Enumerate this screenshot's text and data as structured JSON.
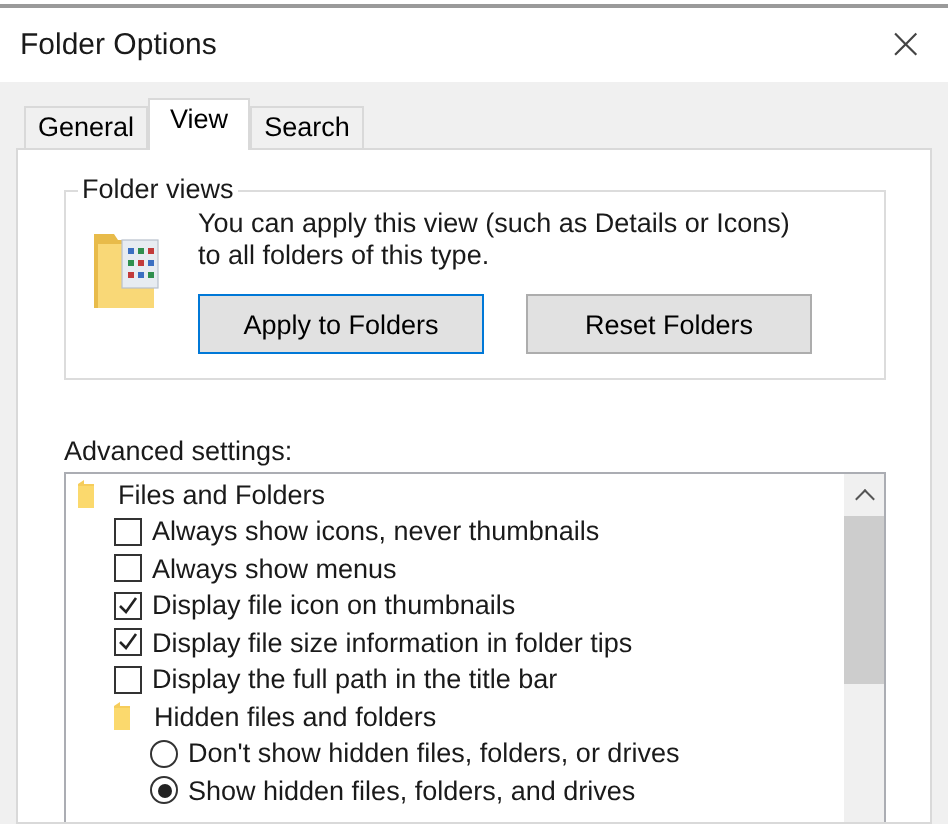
{
  "window": {
    "title": "Folder Options",
    "close": "×"
  },
  "tabs": [
    {
      "label": "General",
      "selected": false
    },
    {
      "label": "View",
      "selected": true
    },
    {
      "label": "Search",
      "selected": false
    }
  ],
  "folder_views": {
    "title": "Folder views",
    "description": "You can apply this view (such as Details or Icons) to all folders of this type.",
    "buttons": [
      {
        "label": "Apply to Folders",
        "focused": true
      },
      {
        "label": "Reset Folders",
        "focused": false
      }
    ]
  },
  "advanced": {
    "label": "Advanced settings:",
    "items": [
      {
        "kind": "folder",
        "label": "Files and Folders",
        "children": [
          {
            "kind": "checkbox",
            "label": "Always show icons, never thumbnails",
            "checked": false
          },
          {
            "kind": "checkbox",
            "label": "Always show menus",
            "checked": false
          },
          {
            "kind": "checkbox",
            "label": "Display file icon on thumbnails",
            "checked": true
          },
          {
            "kind": "checkbox",
            "label": "Display file size information in folder tips",
            "checked": true
          },
          {
            "kind": "checkbox",
            "label": "Display the full path in the title bar",
            "checked": false
          },
          {
            "kind": "folder",
            "label": "Hidden files and folders",
            "children": [
              {
                "kind": "radio",
                "label": "Don't show hidden files, folders, or drives",
                "selected": false
              },
              {
                "kind": "radio",
                "label": "Show hidden files, folders, and drives",
                "selected": true
              }
            ]
          }
        ]
      }
    ]
  }
}
